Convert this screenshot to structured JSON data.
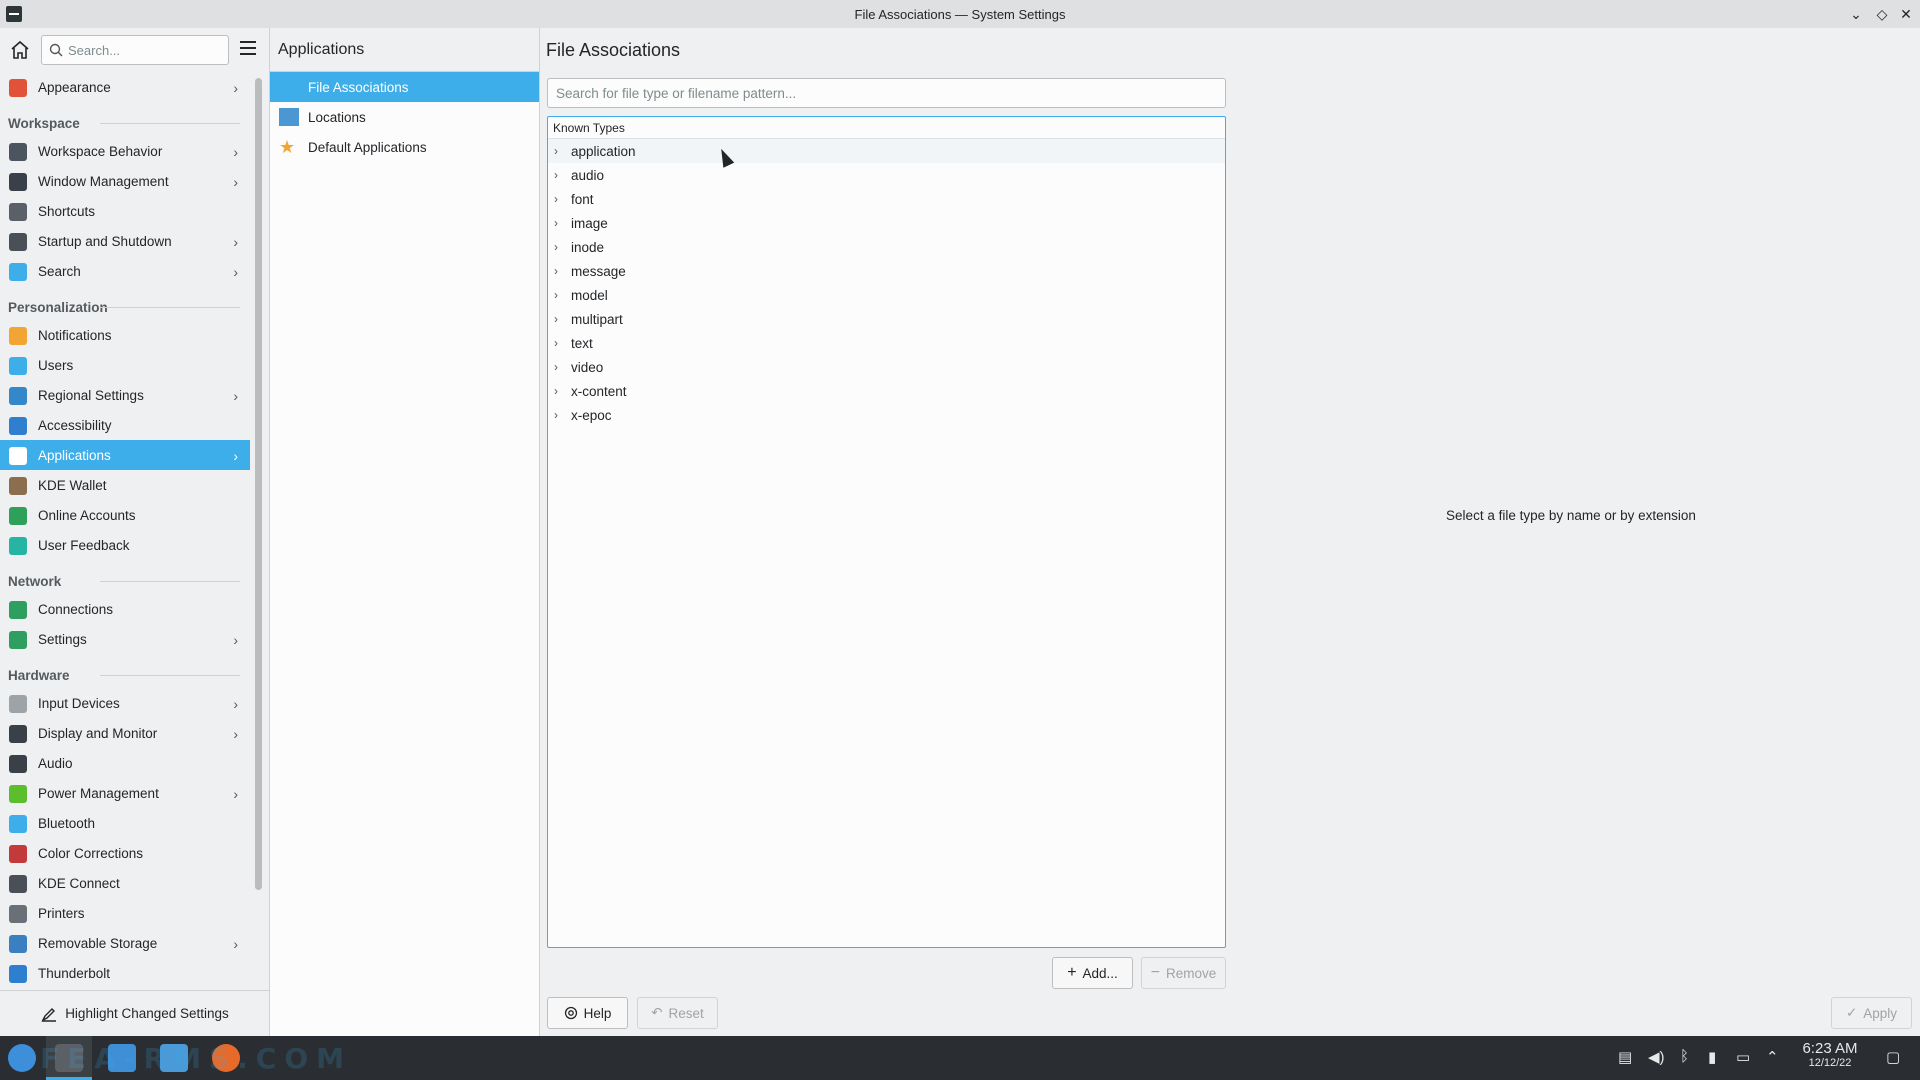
{
  "window": {
    "title": "File Associations — System Settings",
    "controls": [
      "minimize",
      "maximize",
      "close"
    ]
  },
  "sidebar": {
    "search_placeholder": "Search...",
    "items": [
      {
        "type": "item",
        "label": "Appearance",
        "icon": "appearance-icon",
        "color": "#e0533a",
        "chevron": true
      },
      {
        "type": "category",
        "label": "Workspace"
      },
      {
        "type": "item",
        "label": "Workspace Behavior",
        "icon": "workspace-behavior-icon",
        "color": "#4b5560",
        "chevron": true
      },
      {
        "type": "item",
        "label": "Window Management",
        "icon": "window-management-icon",
        "color": "#3a4048",
        "chevron": true
      },
      {
        "type": "item",
        "label": "Shortcuts",
        "icon": "keyboard-icon",
        "color": "#5a6068",
        "chevron": false
      },
      {
        "type": "item",
        "label": "Startup and Shutdown",
        "icon": "startup-icon",
        "color": "#4a5058",
        "chevron": true
      },
      {
        "type": "item",
        "label": "Search",
        "icon": "search-icon",
        "color": "#3daee9",
        "chevron": true
      },
      {
        "type": "category",
        "label": "Personalization"
      },
      {
        "type": "item",
        "label": "Notifications",
        "icon": "bell-icon",
        "color": "#f2a533",
        "chevron": false
      },
      {
        "type": "item",
        "label": "Users",
        "icon": "users-icon",
        "color": "#3daee9",
        "chevron": false
      },
      {
        "type": "item",
        "label": "Regional Settings",
        "icon": "regional-icon",
        "color": "#3488c9",
        "chevron": true
      },
      {
        "type": "item",
        "label": "Accessibility",
        "icon": "accessibility-icon",
        "color": "#2f7fd0",
        "chevron": false
      },
      {
        "type": "item",
        "label": "Applications",
        "icon": "applications-icon",
        "color": "#ffffff",
        "chevron": true,
        "active": true
      },
      {
        "type": "item",
        "label": "KDE Wallet",
        "icon": "wallet-icon",
        "color": "#8a6e4e",
        "chevron": false
      },
      {
        "type": "item",
        "label": "Online Accounts",
        "icon": "online-accounts-icon",
        "color": "#2fa05a",
        "chevron": false
      },
      {
        "type": "item",
        "label": "User Feedback",
        "icon": "feedback-icon",
        "color": "#27b5a3",
        "chevron": false
      },
      {
        "type": "category",
        "label": "Network"
      },
      {
        "type": "item",
        "label": "Connections",
        "icon": "connections-icon",
        "color": "#2f9e61",
        "chevron": false
      },
      {
        "type": "item",
        "label": "Settings",
        "icon": "network-settings-icon",
        "color": "#2f9e61",
        "chevron": true
      },
      {
        "type": "category",
        "label": "Hardware"
      },
      {
        "type": "item",
        "label": "Input Devices",
        "icon": "mouse-icon",
        "color": "#9ea3a8",
        "chevron": true
      },
      {
        "type": "item",
        "label": "Display and Monitor",
        "icon": "monitor-icon",
        "color": "#3a4048",
        "chevron": true
      },
      {
        "type": "item",
        "label": "Audio",
        "icon": "speaker-icon",
        "color": "#3a4048",
        "chevron": false
      },
      {
        "type": "item",
        "label": "Power Management",
        "icon": "power-icon",
        "color": "#5cbe2d",
        "chevron": true
      },
      {
        "type": "item",
        "label": "Bluetooth",
        "icon": "bluetooth-icon",
        "color": "#3daee9",
        "chevron": false
      },
      {
        "type": "item",
        "label": "Color Corrections",
        "icon": "color-icon",
        "color": "#c23a3a",
        "chevron": false
      },
      {
        "type": "item",
        "label": "KDE Connect",
        "icon": "phone-icon",
        "color": "#4a5058",
        "chevron": false
      },
      {
        "type": "item",
        "label": "Printers",
        "icon": "printer-icon",
        "color": "#6a7078",
        "chevron": false
      },
      {
        "type": "item",
        "label": "Removable Storage",
        "icon": "usb-icon",
        "color": "#3a7fc0",
        "chevron": true
      },
      {
        "type": "item",
        "label": "Thunderbolt",
        "icon": "thunderbolt-icon",
        "color": "#2f7fd0",
        "chevron": false
      }
    ],
    "footer_label": "Highlight Changed Settings"
  },
  "subpanel": {
    "title": "Applications",
    "items": [
      {
        "label": "File Associations",
        "icon": "file-associations-icon",
        "active": true
      },
      {
        "label": "Locations",
        "icon": "folder-icon",
        "active": false
      },
      {
        "label": "Default Applications",
        "icon": "star-icon",
        "active": false
      }
    ]
  },
  "main": {
    "title": "File Associations",
    "filter_placeholder": "Search for file type or filename pattern...",
    "tree_header": "Known Types",
    "known_types": [
      "application",
      "audio",
      "font",
      "image",
      "inode",
      "message",
      "model",
      "multipart",
      "text",
      "video",
      "x-content",
      "x-epoc"
    ],
    "detail_message": "Select a file type by name or by extension",
    "add_label": "Add...",
    "remove_label": "Remove",
    "help_label": "Help",
    "reset_label": "Reset",
    "apply_label": "Apply"
  },
  "taskbar": {
    "time": "6:23 AM",
    "date": "12/12/22",
    "watermark": "FEA-RMS.COM"
  },
  "colors": {
    "accent": "#3daee9",
    "taskbar_bg": "#2a2e32",
    "window_bg": "#eff0f1"
  }
}
